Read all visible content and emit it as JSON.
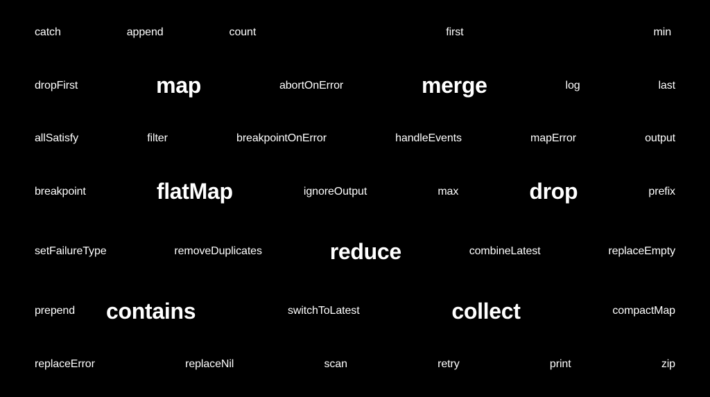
{
  "rows": [
    [
      {
        "text": "catch",
        "big": false
      },
      {
        "text": "append",
        "big": false
      },
      {
        "text": "count",
        "big": false
      },
      {
        "text": "first",
        "big": false
      },
      {
        "text": "min",
        "big": false
      }
    ],
    [
      {
        "text": "dropFirst",
        "big": false
      },
      {
        "text": "map",
        "big": true
      },
      {
        "text": "abortOnError",
        "big": false
      },
      {
        "text": "merge",
        "big": true
      },
      {
        "text": "log",
        "big": false
      },
      {
        "text": "last",
        "big": false
      }
    ],
    [
      {
        "text": "allSatisfy",
        "big": false
      },
      {
        "text": "filter",
        "big": false
      },
      {
        "text": "breakpointOnError",
        "big": false
      },
      {
        "text": "handleEvents",
        "big": false
      },
      {
        "text": "mapError",
        "big": false
      },
      {
        "text": "output",
        "big": false
      }
    ],
    [
      {
        "text": "breakpoint",
        "big": false
      },
      {
        "text": "flatMap",
        "big": true
      },
      {
        "text": "ignoreOutput",
        "big": false
      },
      {
        "text": "max",
        "big": false
      },
      {
        "text": "drop",
        "big": true
      },
      {
        "text": "prefix",
        "big": false
      }
    ],
    [
      {
        "text": "setFailureType",
        "big": false
      },
      {
        "text": "removeDuplicates",
        "big": false
      },
      {
        "text": "reduce",
        "big": true
      },
      {
        "text": "combineLatest",
        "big": false
      },
      {
        "text": "replaceEmpty",
        "big": false
      }
    ],
    [
      {
        "text": "prepend",
        "big": false
      },
      {
        "text": "contains",
        "big": true
      },
      {
        "text": "switchToLatest",
        "big": false
      },
      {
        "text": "collect",
        "big": true
      },
      {
        "text": "compactMap",
        "big": false
      }
    ],
    [
      {
        "text": "replaceError",
        "big": false
      },
      {
        "text": "replaceNil",
        "big": false
      },
      {
        "text": "scan",
        "big": false
      },
      {
        "text": "retry",
        "big": false
      },
      {
        "text": "print",
        "big": false
      },
      {
        "text": "zip",
        "big": false
      }
    ]
  ]
}
